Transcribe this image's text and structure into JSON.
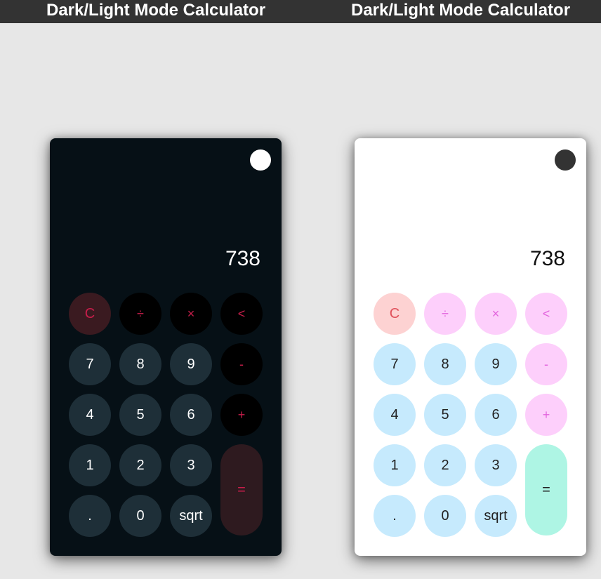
{
  "page": {
    "title_left": "Dark/Light Mode Calculator",
    "title_right": "Dark/Light Mode Calculator"
  },
  "dark_calculator": {
    "theme": "dark",
    "display": "738",
    "toggle_icon": "circle-toggle-icon",
    "keys": {
      "clear": "C",
      "divide": "÷",
      "multiply": "×",
      "backspace": "<",
      "seven": "7",
      "eight": "8",
      "nine": "9",
      "minus": "-",
      "four": "4",
      "five": "5",
      "six": "6",
      "plus": "+",
      "one": "1",
      "two": "2",
      "three": "3",
      "equals": "=",
      "dot": ".",
      "zero": "0",
      "sqrt": "sqrt"
    },
    "colors": {
      "background": "#061016",
      "number_key": "#1e2f38",
      "operator_text": "#c81e4b"
    }
  },
  "light_calculator": {
    "theme": "light",
    "display": "738",
    "toggle_icon": "circle-toggle-icon",
    "keys": {
      "clear": "C",
      "divide": "÷",
      "multiply": "×",
      "backspace": "<",
      "seven": "7",
      "eight": "8",
      "nine": "9",
      "minus": "-",
      "four": "4",
      "five": "5",
      "six": "6",
      "plus": "+",
      "one": "1",
      "two": "2",
      "three": "3",
      "equals": "=",
      "dot": ".",
      "zero": "0",
      "sqrt": "sqrt"
    },
    "colors": {
      "background": "#ffffff",
      "number_key": "#c6eafd",
      "operator_key": "#fdcffb",
      "equals_key": "#aef5e4"
    }
  }
}
